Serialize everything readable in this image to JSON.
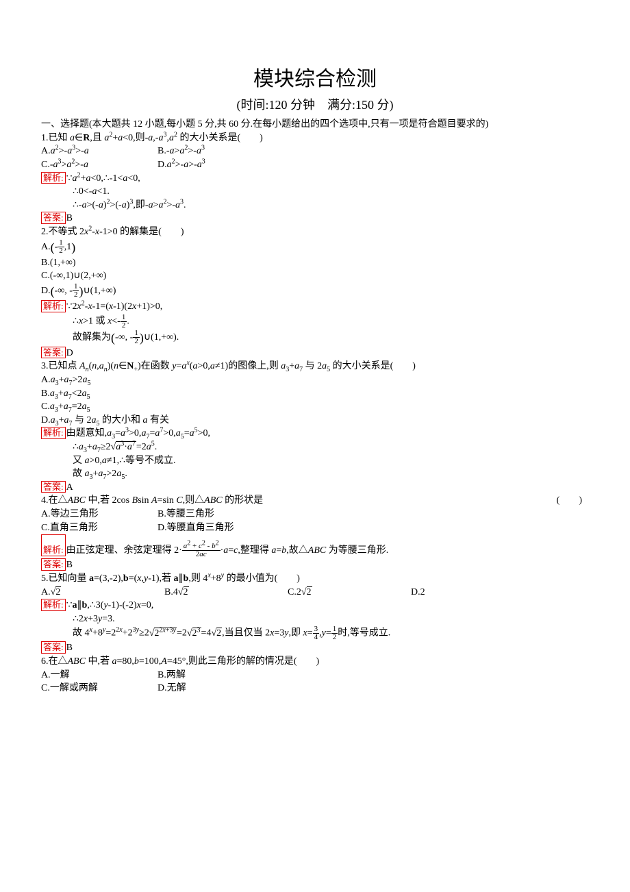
{
  "title": "模块综合检测",
  "subtitle": "(时间:120 分钟　满分:150 分)",
  "sec1": "一、选择题(本大题共 12 小题,每小题 5 分,共 60 分.在每小题给出的四个选项中,只有一项是符合题目要求的)",
  "q1": {
    "stem": "1.已知 a∈R,且 a²+a<0,则-a,-a³,a² 的大小关系是(　　)",
    "optA": "A.a²>-a³>-a",
    "optB": "B.-a>a²>-a³",
    "optC": "C.-a³>a²>-a",
    "optD": "D.a²>-a>-a³",
    "ana_label": "解析:",
    "ana1": "∵a²+a<0,∴-1<a<0,",
    "ana2": "∴0<-a<1.",
    "ana3": "∴-a>(-a)²>(-a)³,即-a>a²>-a³.",
    "ans_label": "答案:",
    "ans": "B"
  },
  "q2": {
    "stem": "2.不等式 2x²-x-1>0 的解集是(　　)",
    "optA_pre": "A.",
    "optA_l": "(",
    "optA_neg": "-",
    "optA_num": "1",
    "optA_den": "2",
    "optA_tail": ",1)",
    "optB": "B.(1,+∞)",
    "optC": "C.(-∞,1)∪(2,+∞)",
    "optD_pre": "D.",
    "optD_l": "(",
    "optD_txt": "-∞, -",
    "optD_num": "1",
    "optD_den": "2",
    "optD_r": ")",
    "optD_tail": "∪(1,+∞)",
    "ana_label": "解析:",
    "ana1": "∵2x²-x-1=(x-1)(2x+1)>0,",
    "ana2_pre": "∴x>1 或 x<-",
    "ana2_num": "1",
    "ana2_den": "2",
    "ana2_tail": ".",
    "ana3_pre": "故解集为",
    "ana3_l": "(",
    "ana3_txt": "-∞, -",
    "ana3_num": "1",
    "ana3_den": "2",
    "ana3_r": ")",
    "ana3_tail": "∪(1,+∞).",
    "ans_label": "答案:",
    "ans": "D"
  },
  "q3": {
    "stem": "3.已知点 Aₙ(n,aₙ)(n∈N₊)在函数 y=aˣ(a>0,a≠1)的图像上,则 a₃+a₇ 与 2a₅ 的大小关系是(　　)",
    "optA": "A.a₃+a₇>2a₅",
    "optB": "B.a₃+a₇<2a₅",
    "optC": "C.a₃+a₇=2a₅",
    "optD": "D.a₃+a₇ 与 2a₅ 的大小和 a 有关",
    "ana_label": "解析:",
    "ana1": "由题意知,a₃=a³>0,a₇=a⁷>0,a₅=a⁵>0,",
    "ana2_pre": "∴a₃+a₇≥2",
    "ana2_rad": "a³·a⁷",
    "ana2_tail": "=2a⁵.",
    "ana3": "又 a>0,a≠1,∴等号不成立.",
    "ana4": "故 a₃+a₇>2a₅.",
    "ans_label": "答案:",
    "ans": "A"
  },
  "q4": {
    "stem_l": "4.在△ABC 中,若 2cos Bsin A=sin C,则△ABC 的形状是",
    "stem_r": "(　　)",
    "optA": "A.等边三角形",
    "optB": "B.等腰三角形",
    "optC": "C.直角三角形",
    "optD": "D.等腰直角三角形",
    "ana_label": "解析:",
    "ana1_pre": "由正弦定理、余弦定理得 2·",
    "ana1_num": "a² + c² - b²",
    "ana1_den": "2ac",
    "ana1_tail": "·a=c,整理得 a=b,故△ABC 为等腰三角形.",
    "ans_label": "答案:",
    "ans": "B"
  },
  "q5": {
    "stem": "5.已知向量 a=(3,-2),b=(x,y-1),若 a∥b,则 4ˣ+8ʸ 的最小值为(　　)",
    "optA_pre": "A.",
    "optA_rad": "2",
    "optB_pre": "B.4",
    "optB_rad": "2",
    "optC_pre": "C.2",
    "optC_rad": "2",
    "optD": "D.2",
    "ana_label": "解析:",
    "ana1": "∵a∥b,∴3(y-1)-(-2)x=0,",
    "ana2": "∴2x+3y=3.",
    "ana3_pre": "故 4ˣ+8ʸ=2²ˣ+2³ʸ≥2",
    "ana3_rad1": "2^(2x+3y)",
    "ana3_mid1": "=2",
    "ana3_rad2": "2³",
    "ana3_mid2": "=4",
    "ana3_rad3": "2",
    "ana3_mid3": ",当且仅当 2x=3y,即 x=",
    "ana3_n1": "3",
    "ana3_d1": "4",
    "ana3_mid4": ",y=",
    "ana3_n2": "1",
    "ana3_d2": "2",
    "ana3_tail": "时,等号成立.",
    "ans_label": "答案:",
    "ans": "B"
  },
  "q6": {
    "stem": "6.在△ABC 中,若 a=80,b=100,A=45°,则此三角形的解的情况是(　　)",
    "optA": "A.一解",
    "optB": "B.两解",
    "optC": "C.一解或两解",
    "optD": "D.无解"
  }
}
